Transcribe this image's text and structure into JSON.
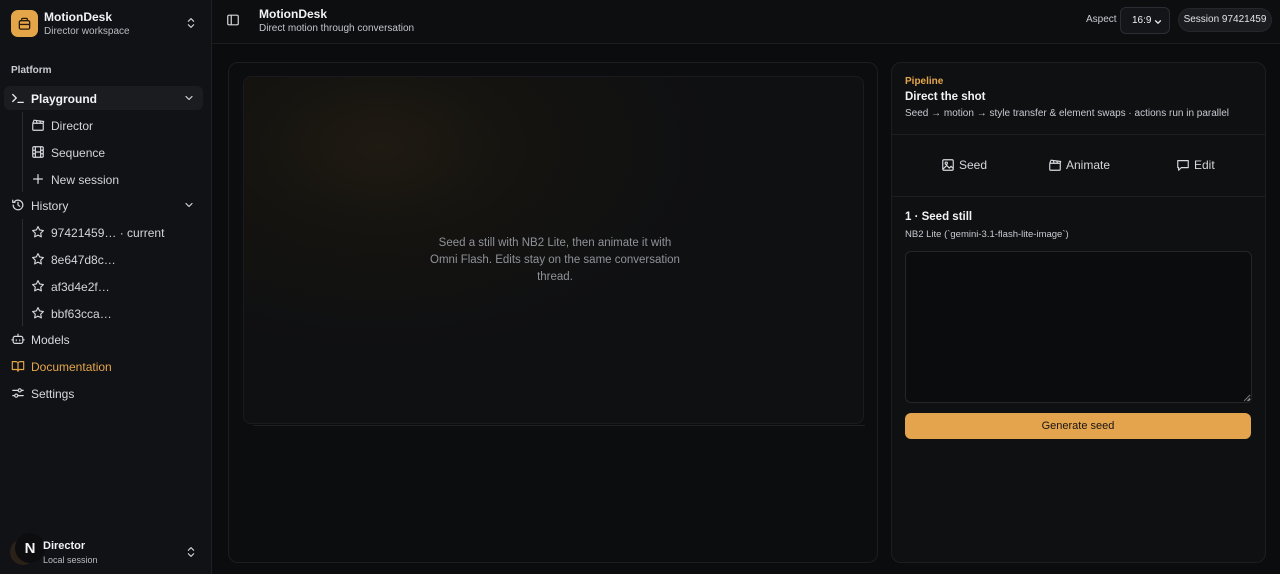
{
  "workspace": {
    "name": "MotionDesk",
    "subtitle": "Director workspace"
  },
  "sidebar": {
    "section_label": "Platform",
    "playground": {
      "label": "Playground",
      "children": [
        {
          "label": "Director",
          "icon": "clapperboard-icon"
        },
        {
          "label": "Sequence",
          "icon": "film-icon"
        },
        {
          "label": "New session",
          "icon": "plus-icon"
        }
      ]
    },
    "history": {
      "label": "History",
      "items": [
        {
          "label": "97421459… · current",
          "icon": "star-icon"
        },
        {
          "label": "8e647d8c…",
          "icon": "star-icon"
        },
        {
          "label": "af3d4e2f…",
          "icon": "star-icon"
        },
        {
          "label": "bbf63cca…",
          "icon": "star-icon"
        }
      ]
    },
    "models": {
      "label": "Models"
    },
    "documentation": {
      "label": "Documentation"
    },
    "settings": {
      "label": "Settings"
    }
  },
  "user": {
    "badge": "N",
    "name": "Director",
    "subtitle": "Local session"
  },
  "header": {
    "title": "MotionDesk",
    "subtitle": "Direct motion through conversation",
    "aspect_label": "Aspect",
    "aspect_value": "16:9",
    "session": "Session 97421459"
  },
  "canvas": {
    "hint": "Seed a still with NB2 Lite, then animate it with Omni Flash. Edits stay on the same conversation thread."
  },
  "pipeline": {
    "eyebrow": "Pipeline",
    "title": "Direct the shot",
    "description": "Seed → motion → style transfer & element swaps · actions run in parallel",
    "tabs": [
      {
        "label": "Seed",
        "icon": "image-icon"
      },
      {
        "label": "Animate",
        "icon": "clapperboard-icon"
      },
      {
        "label": "Edit",
        "icon": "message-square-icon"
      }
    ],
    "step_title": "1 · Seed still",
    "step_model": "NB2 Lite (`gemini-3.1-flash-lite-image`)",
    "prompt_value": "",
    "generate_label": "Generate seed"
  },
  "colors": {
    "accent": "#e5a64a",
    "background": "#0b0c0e",
    "sidebar": "#111215"
  }
}
